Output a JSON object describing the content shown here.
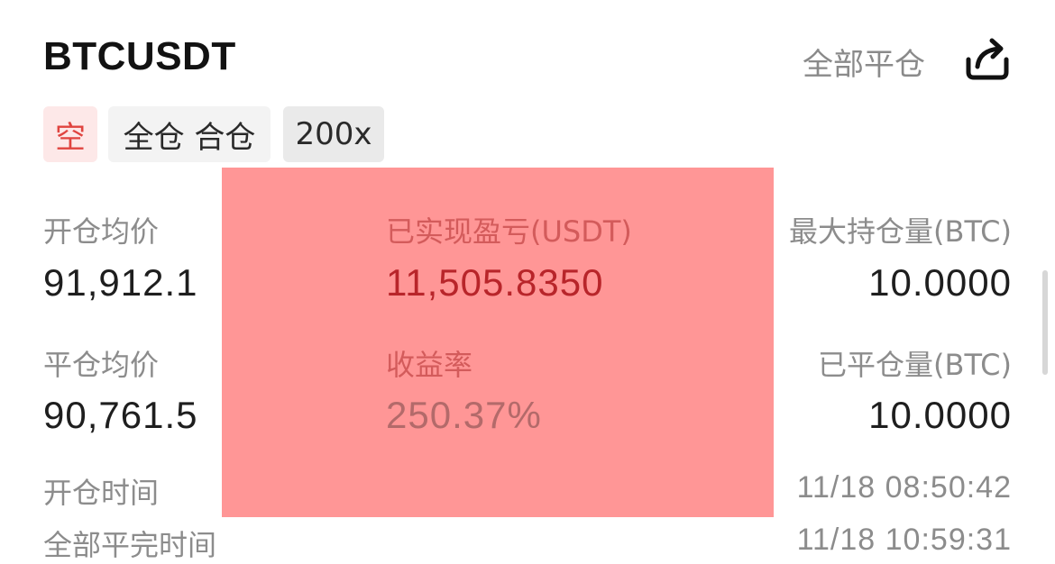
{
  "header": {
    "symbol": "BTCUSDT",
    "close_all_label": "全部平仓",
    "share_icon": "share-icon"
  },
  "tags": {
    "side": "空",
    "margin_mode": "全仓 合仓",
    "leverage": "200x"
  },
  "stats": {
    "avg_open_price_label": "开仓均价",
    "avg_open_price": "91,912.1",
    "avg_close_price_label": "平仓均价",
    "avg_close_price": "90,761.5",
    "realized_pnl_label": "已实现盈亏(USDT)",
    "realized_pnl": "11,505.8350",
    "roi_label": "收益率",
    "roi": "250.37%",
    "max_position_label": "最大持仓量(BTC)",
    "max_position": "10.0000",
    "closed_amount_label": "已平仓量(BTC)",
    "closed_amount": "10.0000",
    "open_time_label": "开仓时间",
    "open_time": "11/18 08:50:42",
    "full_close_time_label": "全部平完时间",
    "full_close_time": "11/18 10:59:31"
  },
  "colors": {
    "overlay": "#ff9696",
    "short_tag_text": "#e0443f",
    "pnl_text": "#b8252a"
  }
}
